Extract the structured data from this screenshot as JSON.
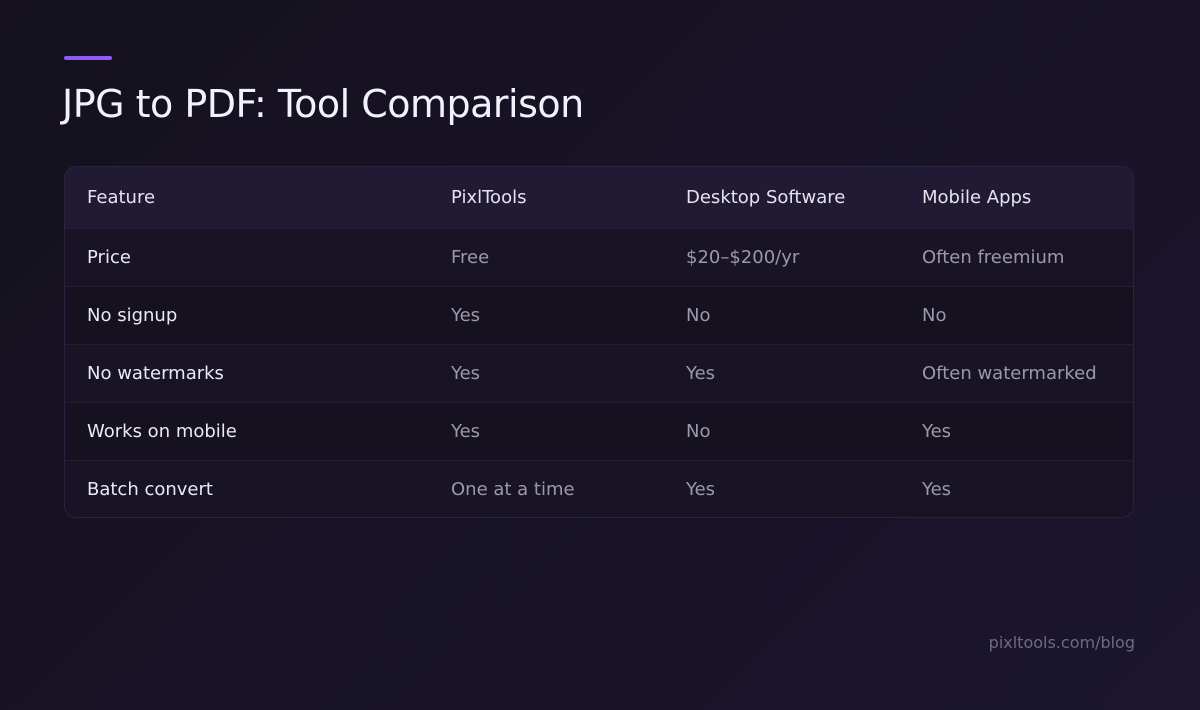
{
  "page": {
    "title": "JPG to PDF: Tool Comparison",
    "footer": "pixltools.com/blog",
    "accent_color": "#8b5cf6"
  },
  "table": {
    "headers": [
      "Feature",
      "PixlTools",
      "Desktop Software",
      "Mobile Apps"
    ],
    "rows": [
      [
        "Price",
        "Free",
        "$20–$200/yr",
        "Often freemium"
      ],
      [
        "No signup",
        "Yes",
        "No",
        "No"
      ],
      [
        "No watermarks",
        "Yes",
        "Yes",
        "Often watermarked"
      ],
      [
        "Works on mobile",
        "Yes",
        "No",
        "Yes"
      ],
      [
        "Batch convert",
        "One at a time",
        "Yes",
        "Yes"
      ]
    ]
  }
}
